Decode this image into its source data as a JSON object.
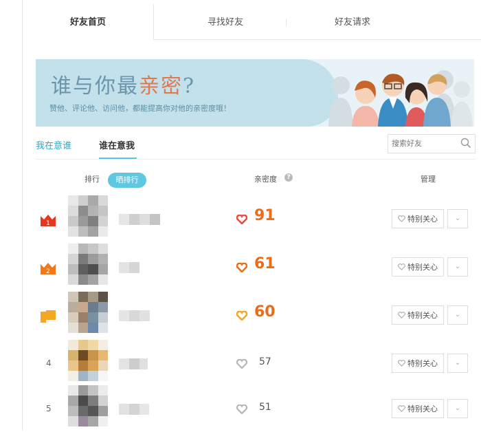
{
  "tabs": [
    "好友首页",
    "寻找好友",
    "好友请求"
  ],
  "banner": {
    "title_before": "谁与你最",
    "title_highlight": "亲密",
    "title_after": "?",
    "subtitle": "赞他、评论他、访问他，都能提高你对他的亲密度哦！"
  },
  "subtabs": [
    "我在意谁",
    "谁在意我"
  ],
  "search": {
    "placeholder": "搜索好友"
  },
  "header": {
    "rank": "排行",
    "share_rank": "晒排行",
    "intimacy": "亲密度",
    "manage": "管理"
  },
  "rows": [
    {
      "rank": "1",
      "score": "91",
      "care_label": "特别关心"
    },
    {
      "rank": "2",
      "score": "61",
      "care_label": "特别关心"
    },
    {
      "rank": "3",
      "score": "60",
      "care_label": "特别关心"
    },
    {
      "rank": "4",
      "score": "57",
      "care_label": "特别关心"
    },
    {
      "rank": "5",
      "score": "51",
      "care_label": "特别关心"
    }
  ],
  "colors": {
    "accent": "#54c6dd",
    "score_orange": "#ee6b18",
    "heart_red": "#e74c3c",
    "badge_red": "#e8371f",
    "badge_orange": "#f07a1a",
    "badge_yellow": "#f5a623"
  }
}
